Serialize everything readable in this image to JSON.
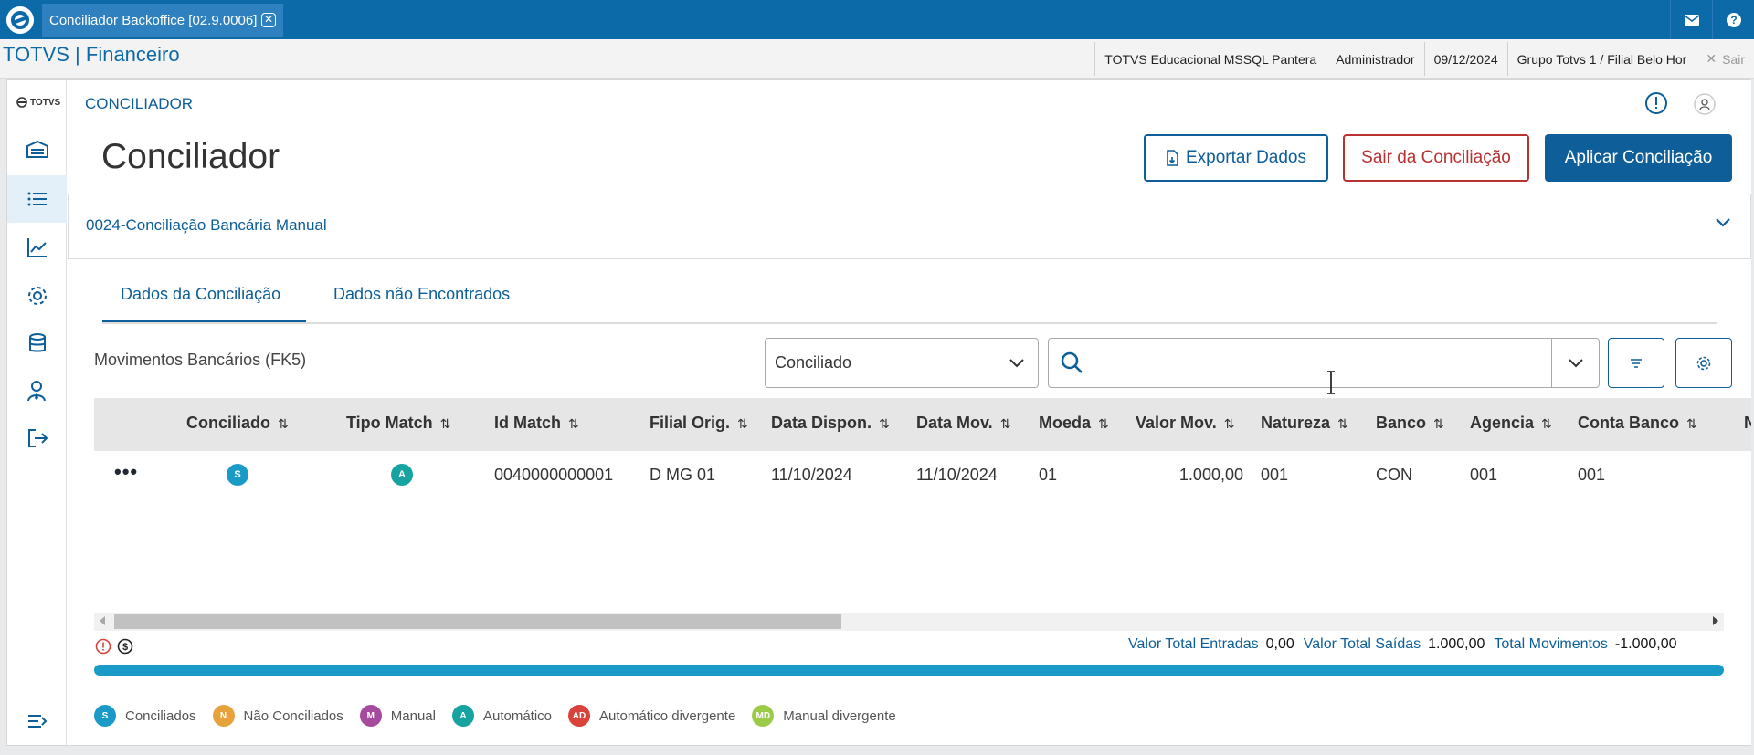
{
  "window": {
    "tab_title": "Conciliador Backoffice [02.9.0006]",
    "tab_close": "✕"
  },
  "app": {
    "title": "TOTVS | Financeiro",
    "info": [
      "TOTVS Educacional MSSQL Pantera",
      "Administrador",
      "09/12/2024",
      "Grupo Totvs 1 / Filial Belo Hor"
    ],
    "exit_label": "Sair"
  },
  "sidebar": {
    "logo": "TOTVS",
    "items": [
      "warehouse-icon",
      "list-icon",
      "chart-icon",
      "settings-icon",
      "database-icon",
      "user-tie-icon",
      "logout-icon"
    ],
    "collapse": "collapse-menu-icon"
  },
  "header": {
    "breadcrumb": "CONCILIADOR"
  },
  "page": {
    "title": "Conciliador",
    "buttons": {
      "export": "Exportar Dados",
      "exit": "Sair da Conciliação",
      "apply": "Aplicar Conciliação"
    },
    "accordion_title": "0024-Conciliação Bancária Manual",
    "tabs": [
      "Dados da Conciliação",
      "Dados não Encontrados"
    ],
    "section_title": "Movimentos Bancários (FK5)",
    "status_filter": "Conciliado",
    "search_value": "",
    "search_placeholder": ""
  },
  "table": {
    "columns": [
      "Conciliado",
      "Tipo Match",
      "Id Match",
      "Filial Orig.",
      "Data Dispon.",
      "Data Mov.",
      "Moeda",
      "Valor Mov.",
      "Natureza",
      "Banco",
      "Agencia",
      "Conta Banco",
      "Nu"
    ],
    "sort_glyph": "⇅",
    "row": {
      "actions": "•••",
      "conciliado": "S",
      "tipo_match": "A",
      "id_match": "0040000000001",
      "filial": "D MG 01",
      "data_dispon": "11/10/2024",
      "data_mov": "11/10/2024",
      "moeda": "01",
      "valor": "1.000,00",
      "natureza": "001",
      "banco": "CON",
      "agencia": "001",
      "conta": "001"
    }
  },
  "totals": {
    "entradas_label": "Valor Total Entradas",
    "entradas_value": "0,00",
    "saidas_label": "Valor Total Saídas",
    "saidas_value": "1.000,00",
    "mov_label": "Total Movimentos",
    "mov_value": "-1.000,00"
  },
  "legend": [
    {
      "code": "S",
      "label": "Conciliados",
      "color": "#1a9bc7"
    },
    {
      "code": "N",
      "label": "Não Conciliados",
      "color": "#e8a23b"
    },
    {
      "code": "M",
      "label": "Manual",
      "color": "#a54a9c"
    },
    {
      "code": "A",
      "label": "Automático",
      "color": "#17a3a0"
    },
    {
      "code": "AD",
      "label": "Automático divergente",
      "color": "#d9433b"
    },
    {
      "code": "MD",
      "label": "Manual divergente",
      "color": "#9ccb4a"
    }
  ],
  "colors": {
    "primary": "#0d5e99",
    "topbar": "#0d6aa8",
    "danger": "#b83232",
    "badge_s": "#1a9bc7",
    "badge_a": "#17a3a0"
  }
}
